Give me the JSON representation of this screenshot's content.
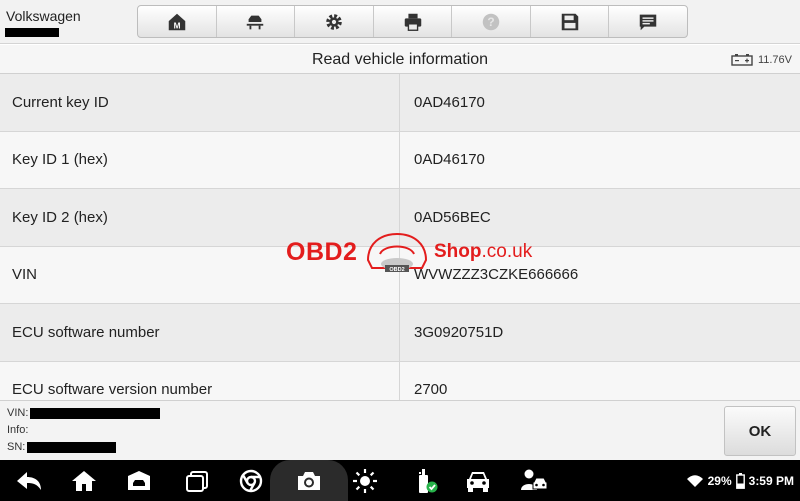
{
  "app": {
    "brand": "Volkswagen"
  },
  "toolbar": {
    "buttons": [
      {
        "icon": "home-m-icon",
        "enabled": true
      },
      {
        "icon": "vehicle-lift-icon",
        "enabled": true
      },
      {
        "icon": "gear-icon",
        "enabled": true
      },
      {
        "icon": "printer-icon",
        "enabled": true
      },
      {
        "icon": "help-icon",
        "enabled": false
      },
      {
        "icon": "save-icon",
        "enabled": true
      },
      {
        "icon": "message-icon",
        "enabled": true
      }
    ]
  },
  "titlebar": {
    "title": "Read vehicle information",
    "battery_voltage": "11.76V"
  },
  "table": {
    "rows": [
      {
        "label": "Current key ID",
        "value": "0AD46170"
      },
      {
        "label": "Key ID 1 (hex)",
        "value": "0AD46170"
      },
      {
        "label": "Key ID 2 (hex)",
        "value": "0AD56BEC"
      },
      {
        "label": "VIN",
        "value": "WVWZZZ3CZKE666666"
      },
      {
        "label": "ECU software number",
        "value": "3G0920751D"
      },
      {
        "label": "ECU software version number",
        "value": "2700"
      }
    ]
  },
  "watermark": {
    "obd": "OBD2",
    "badge": "OBD2",
    "shop": "Shop",
    "domain": ".co.uk"
  },
  "footer": {
    "vin_label": "VIN:",
    "info_label": "Info:",
    "sn_label": "SN:",
    "ok_label": "OK"
  },
  "statusbar": {
    "battery_percent": "29%",
    "time": "3:59 PM"
  },
  "colors": {
    "accent_red": "#e31d1d",
    "nav_background": "#000000",
    "toolbar_icon": "#333333"
  }
}
